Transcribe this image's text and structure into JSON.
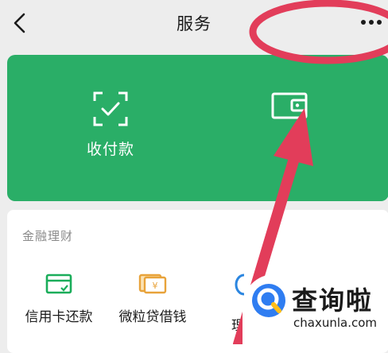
{
  "nav": {
    "title": "服务",
    "back_icon": "chevron-left-icon",
    "more_icon": "more-dots-icon"
  },
  "green_card": {
    "background": "#2aae67",
    "tiles": [
      {
        "label": "收付款",
        "icon": "scan-check-icon"
      },
      {
        "label": "",
        "icon": "wallet-icon"
      }
    ]
  },
  "finance": {
    "title": "金融理财",
    "items": [
      {
        "label": "信用卡还款",
        "icon": "credit-card-icon",
        "color": "#1aad5a"
      },
      {
        "label": "微粒贷借钱",
        "icon": "loan-icon",
        "color": "#e8a33a"
      },
      {
        "label": "理",
        "icon": "wealth-icon",
        "color": "#2b86e0"
      }
    ]
  },
  "annotation": {
    "color": "#e23d5a"
  },
  "watermark": {
    "cn": "查询啦",
    "en": "chaxunla.com"
  }
}
